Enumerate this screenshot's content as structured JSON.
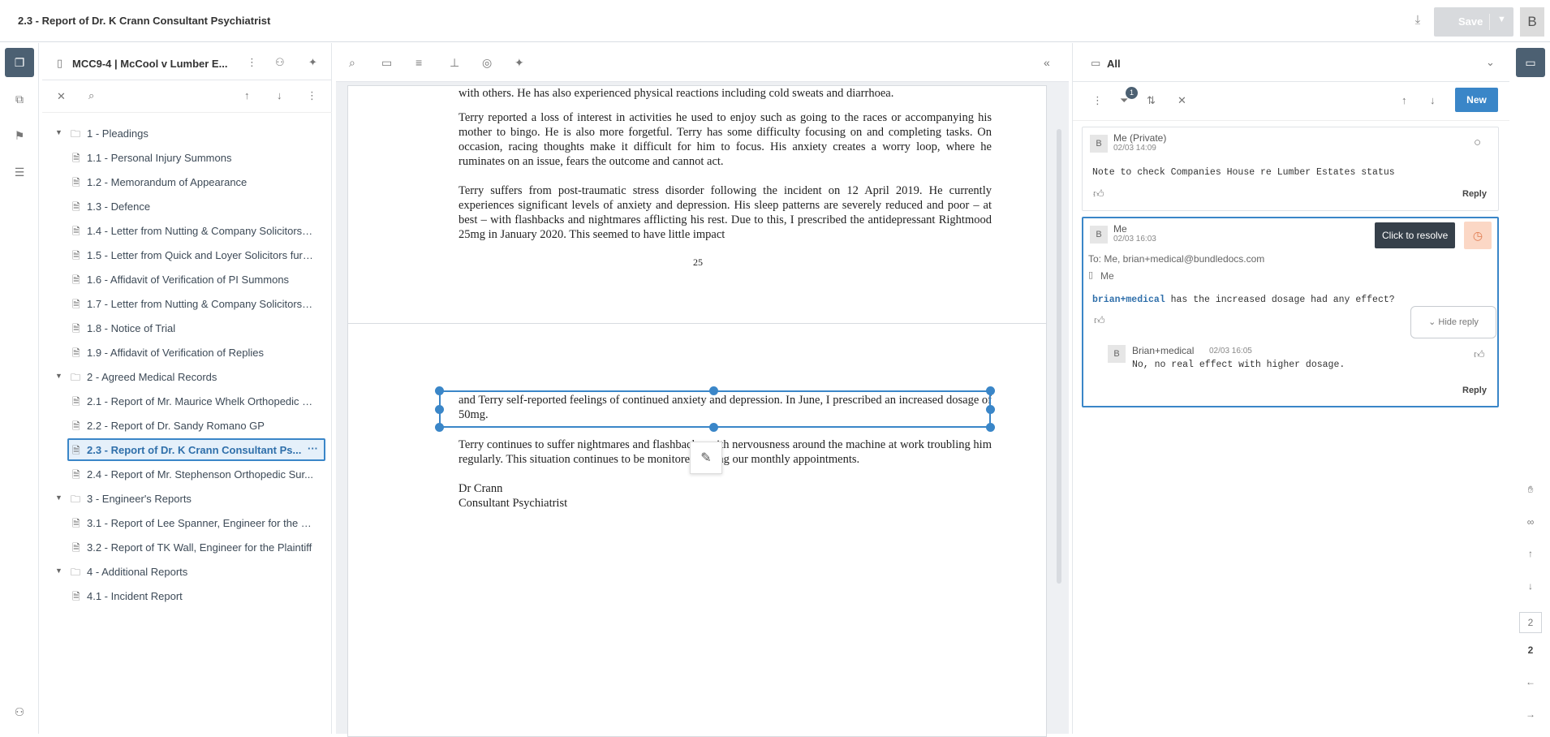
{
  "header": {
    "doc_title": "2.3 - Report of Dr. K Crann Consultant Psychiatrist",
    "save_label": "Save",
    "avatar": "B"
  },
  "tree": {
    "bundle_title": "MCC9-4 | McCool v Lumber E...",
    "nodes": [
      {
        "type": "folder",
        "label": "1 - Pleadings"
      },
      {
        "type": "file",
        "label": "1.1 - Personal Injury Summons"
      },
      {
        "type": "file",
        "label": "1.2 - Memorandum of Appearance"
      },
      {
        "type": "file",
        "label": "1.3 - Defence"
      },
      {
        "type": "file",
        "label": "1.4 - Letter from Nutting & Company Solicitors s..."
      },
      {
        "type": "file",
        "label": "1.5 - Letter from Quick and Loyer Solicitors furni..."
      },
      {
        "type": "file",
        "label": "1.6 - Affidavit of Verification of PI Summons"
      },
      {
        "type": "file",
        "label": "1.7 - Letter from Nutting & Company Solicitors r..."
      },
      {
        "type": "file",
        "label": "1.8 - Notice of Trial"
      },
      {
        "type": "file",
        "label": "1.9 - Affidavit of Verification of Replies"
      },
      {
        "type": "folder",
        "label": "2 - Agreed Medical Records"
      },
      {
        "type": "file",
        "label": "2.1 - Report of Mr. Maurice Whelk Orthopedic S..."
      },
      {
        "type": "file",
        "label": "2.2 - Report of Dr. Sandy Romano GP"
      },
      {
        "type": "file",
        "label": "2.3 - Report of Dr. K Crann Consultant Ps...",
        "selected": true
      },
      {
        "type": "file",
        "label": "2.4 - Report of Mr. Stephenson Orthopedic Sur..."
      },
      {
        "type": "folder",
        "label": "3 - Engineer's Reports"
      },
      {
        "type": "file",
        "label": "3.1 - Report of Lee Spanner, Engineer for the D..."
      },
      {
        "type": "file",
        "label": "3.2 - Report of TK Wall, Engineer for the Plaintiff"
      },
      {
        "type": "folder",
        "label": "4 - Additional Reports"
      },
      {
        "type": "file",
        "label": "4.1 - Incident Report"
      }
    ]
  },
  "document": {
    "page1": {
      "lines_top": "with others.  He has also experienced physical reactions including cold sweats and diarrhoea.",
      "para1": "Terry reported a loss of interest in activities he used to enjoy such as going to the races or accompanying his mother to bingo. He is also more forgetful. Terry has some difficulty focusing on and completing tasks.  On occasion, racing thoughts make it difficult for him to focus.  His anxiety creates a worry loop, where he ruminates on an issue, fears the outcome and cannot act.",
      "para2": "Terry suffers from post-traumatic stress disorder following the incident on 12 April 2019. He currently experiences significant levels of anxiety and depression.  His sleep patterns are severely reduced and poor – at best – with flashbacks and nightmares afflicting his rest.  Due to this, I prescribed the antidepressant Rightmood 25mg in January 2020.  This seemed to have little impact",
      "page_number": "25"
    },
    "page2": {
      "para1": "and Terry self-reported feelings of continued anxiety and depression.  In June, I prescribed an increased dosage of 50mg.",
      "para2": "Terry continues to suffer nightmares and flashbacks, with nervousness around the machine at work troubling him regularly. This situation continues to be monitored during our monthly appointments.",
      "sign1": "Dr Crann",
      "sign2": "Consultant Psychiatrist"
    }
  },
  "comments": {
    "filter_label": "All",
    "filter_count": "1",
    "new_label": "New",
    "items": [
      {
        "avatar": "B",
        "author": "Me (Private)",
        "date": "02/03 14:09",
        "text": "Note to check Companies House re Lumber Estates status",
        "reply_label": "Reply"
      },
      {
        "avatar": "B",
        "author": "Me",
        "date": "02/03 16:03",
        "to": "To: Me, brian+medical@bundledocs.com",
        "tag": "Me",
        "mention": "brian+medical",
        "text": " has the increased dosage had any effect?",
        "tooltip": "Click to resolve",
        "hide_reply": "Hide reply",
        "reply": {
          "avatar": "B",
          "author": "Brian+medical",
          "date": "02/03 16:05",
          "text": "No, no real effect with higher dosage."
        },
        "reply_label": "Reply"
      }
    ]
  },
  "right_rail": {
    "page_input": "2",
    "page_total": "2"
  }
}
